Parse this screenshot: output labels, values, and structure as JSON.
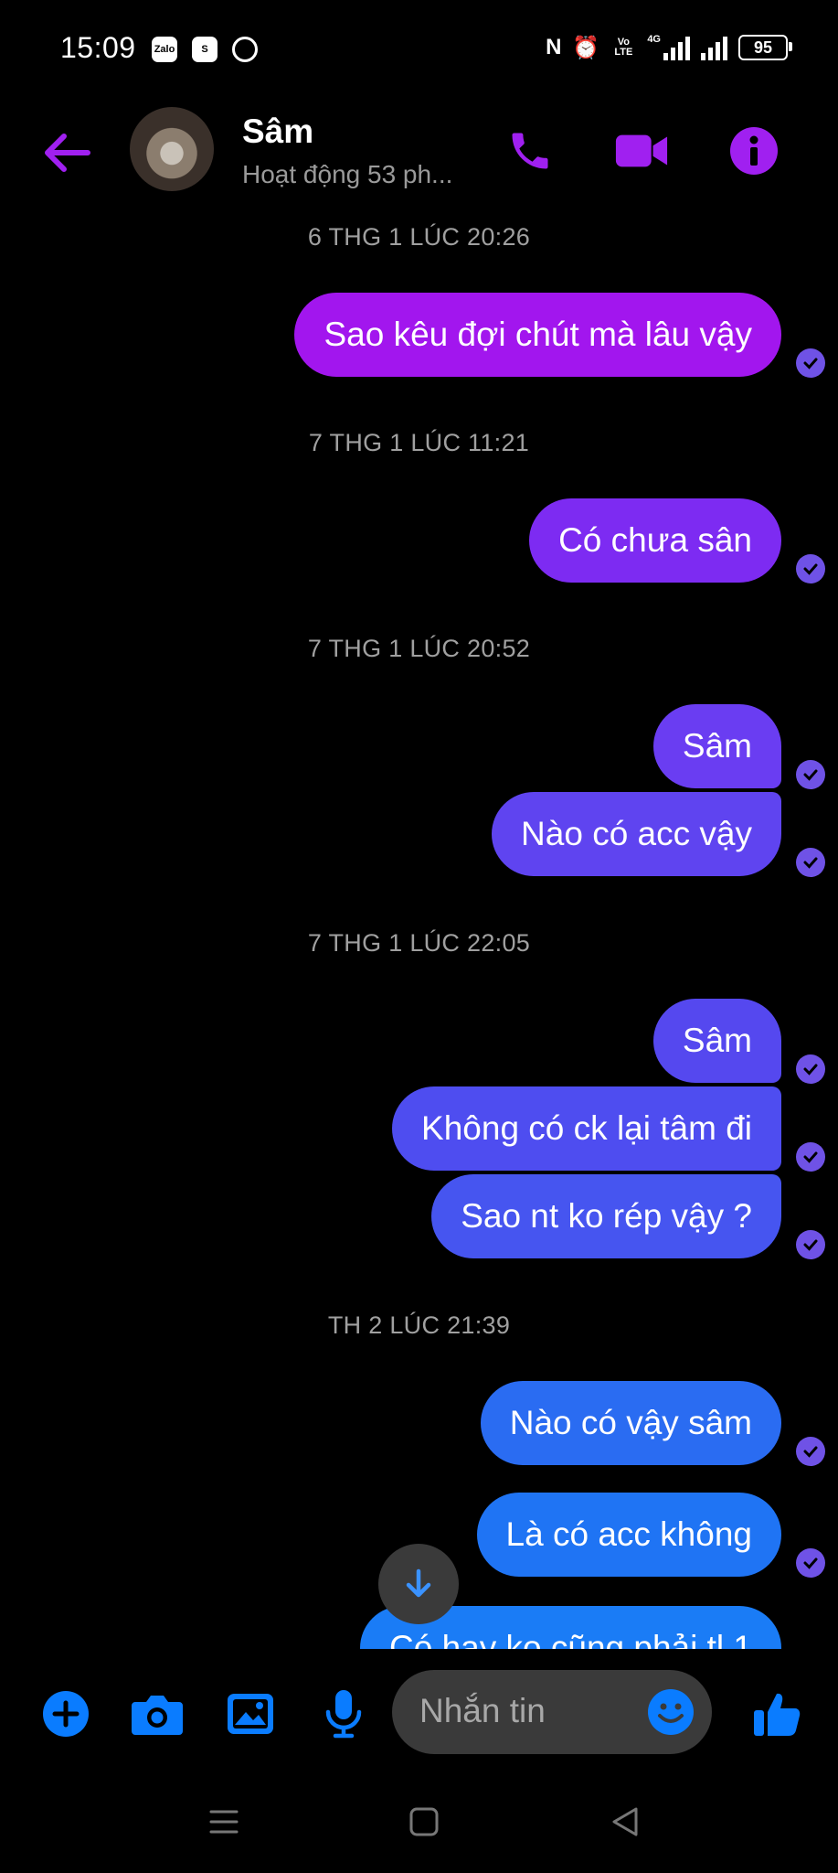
{
  "status_bar": {
    "time": "15:09",
    "apps": [
      "Zalo",
      "S"
    ],
    "network_volte": "Vo LTE",
    "network_4g": "4G",
    "battery": "95"
  },
  "header": {
    "contact_name": "Sâm",
    "status": "Hoạt động 53 ph...",
    "accent_color": "#a020f0"
  },
  "conversation": [
    {
      "type": "timestamp",
      "text": "6 THG 1 LÚC 20:26"
    },
    {
      "type": "message",
      "text": "Sao kêu đợi chút mà lâu vậy",
      "seen": true
    },
    {
      "type": "timestamp",
      "text": "7 THG 1 LÚC 11:21"
    },
    {
      "type": "message",
      "text": "Có chưa sân",
      "seen": true
    },
    {
      "type": "timestamp",
      "text": "7 THG 1 LÚC 20:52"
    },
    {
      "type": "message",
      "text": "Sâm",
      "seen": true
    },
    {
      "type": "message",
      "text": "Nào có acc  vậy",
      "seen": true
    },
    {
      "type": "timestamp",
      "text": "7 THG 1 LÚC 22:05"
    },
    {
      "type": "message",
      "text": "Sâm",
      "seen": true
    },
    {
      "type": "message",
      "text": "Không có ck lại tâm đi",
      "seen": true
    },
    {
      "type": "message",
      "text": "Sao nt ko rép vậy ?",
      "seen": true
    },
    {
      "type": "timestamp",
      "text": "TH 2 LÚC 21:39"
    },
    {
      "type": "message",
      "text": "Nào có vậy sâm",
      "seen": true
    },
    {
      "type": "message",
      "text": "Là có acc không",
      "seen": true
    },
    {
      "type": "message",
      "text": "Có hay ko cũng phải tl 1",
      "seen": false
    }
  ],
  "composer": {
    "placeholder": "Nhắn tin",
    "icon_color": "#0a7cff"
  }
}
